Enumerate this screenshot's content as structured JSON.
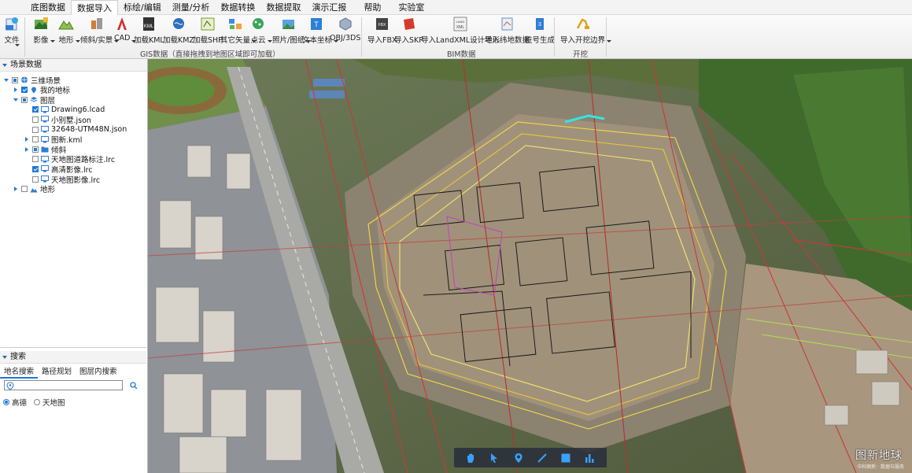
{
  "menu": [
    "底图数据",
    "数据导入",
    "标绘/编辑",
    "测量/分析",
    "数据转换",
    "数据提取",
    "演示汇报",
    "帮助",
    "实验室"
  ],
  "menu_active_index": 1,
  "ribbon": {
    "file_label": "文件",
    "gis_buttons": [
      "影像",
      "地形",
      "倾斜/实景",
      "CAD",
      "加载KML",
      "加载KMZ",
      "加载SHP",
      "其它矢量",
      "点云",
      "照片/图纸",
      "文本坐标",
      "OBJ/3DS"
    ],
    "gis_group_label": "GIS数据（直接拖拽到地图区域即可加载）",
    "bim_buttons": [
      "导入FBX",
      "导入SKP",
      "导入LandXML设计地形",
      "导入纬地数据",
      "桩号生成"
    ],
    "bim_group_label": "BIM数据",
    "excavation_buttons": [
      "导入开挖边界"
    ],
    "excavation_group_label": "开挖"
  },
  "scene_panel": {
    "title": "场景数据",
    "tree": [
      {
        "label": "三维场景",
        "level": 0,
        "expander": "open",
        "check": "part",
        "icon": "globe-icon"
      },
      {
        "label": "我的地标",
        "level": 1,
        "expander": "col",
        "check": "on",
        "icon": "placemark-icon"
      },
      {
        "label": "图层",
        "level": 1,
        "expander": "open",
        "check": "part",
        "icon": "layers-icon"
      },
      {
        "label": "Drawing6.lcad",
        "level": 2,
        "expander": "",
        "check": "on",
        "icon": "monitor-icon"
      },
      {
        "label": "小别墅.json",
        "level": 2,
        "expander": "",
        "check": "off",
        "icon": "monitor-icon"
      },
      {
        "label": "32648-UTM48N.json",
        "level": 2,
        "expander": "",
        "check": "off",
        "icon": "monitor-icon"
      },
      {
        "label": "图新.kml",
        "level": 2,
        "expander": "col",
        "check": "off",
        "icon": "monitor-icon"
      },
      {
        "label": "倾斜",
        "level": 2,
        "expander": "col",
        "check": "part",
        "icon": "folder-icon"
      },
      {
        "label": "天地图道路标注.lrc",
        "level": 2,
        "expander": "",
        "check": "off",
        "icon": "monitor-icon"
      },
      {
        "label": "高清影像.lrc",
        "level": 2,
        "expander": "",
        "check": "on",
        "icon": "monitor-icon"
      },
      {
        "label": "天地图影像.lrc",
        "level": 2,
        "expander": "",
        "check": "off",
        "icon": "monitor-icon"
      },
      {
        "label": "地形",
        "level": 1,
        "expander": "col",
        "check": "off",
        "icon": "terrain-icon"
      }
    ]
  },
  "search_panel": {
    "title": "搜索",
    "tabs": [
      "地名搜索",
      "路径规划",
      "图层内搜索"
    ],
    "input_value": "",
    "radio_options": [
      "高德",
      "天地图"
    ],
    "radio_selected": 0
  },
  "map": {
    "watermark": "图新地球",
    "watermark_sub": "中科图新 · 数据与服务",
    "bottom_tools": [
      "pan-hand-icon",
      "select-arrow-icon",
      "placemark-icon",
      "line-icon",
      "rectangle-icon",
      "chart-icon"
    ]
  }
}
